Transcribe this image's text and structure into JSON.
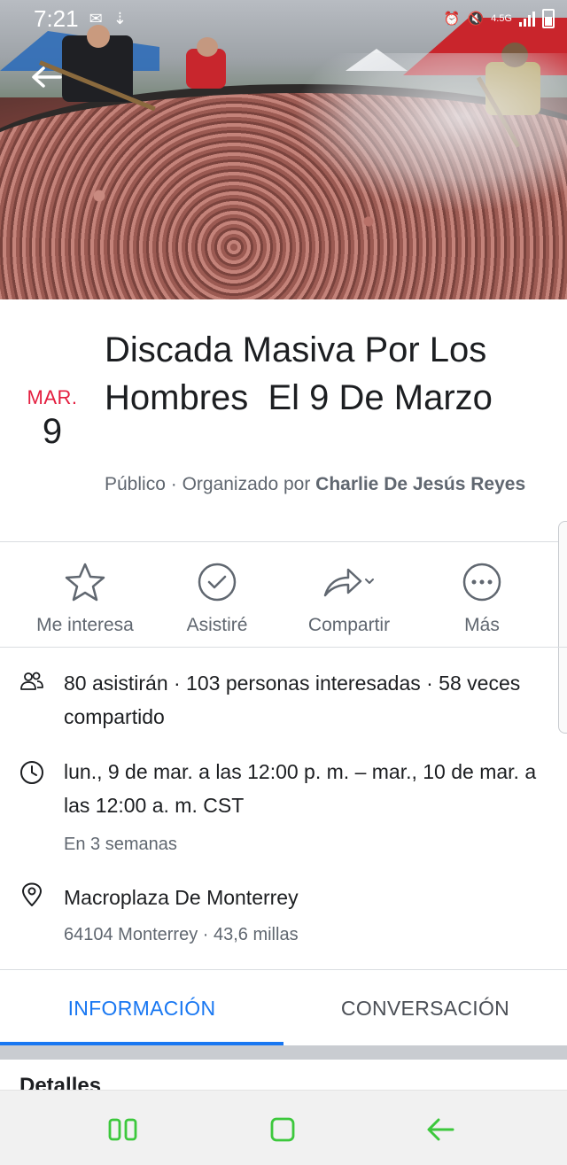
{
  "status_bar": {
    "time": "7:21",
    "network": "4.5G"
  },
  "event": {
    "month": "MAR.",
    "day": "9",
    "title": "Discada Masiva Por Los Hombres  El 9 De Marzo",
    "privacy": "Público",
    "organizer_prefix": "Organizado por",
    "organizer": "Charlie De Jesús Reyes"
  },
  "actions": [
    {
      "label": "Me interesa",
      "icon": "star-icon"
    },
    {
      "label": "Asistiré",
      "icon": "check-circle-icon"
    },
    {
      "label": "Compartir",
      "icon": "share-icon"
    },
    {
      "label": "Más",
      "icon": "more-icon"
    }
  ],
  "info": {
    "attendance": "80 asistirán · 103 personas interesadas · 58 veces compartido",
    "datetime": "lun., 9 de mar. a las 12:00 p. m. – mar., 10 de mar. a las 12:00 a. m. CST",
    "relative": "En 3 semanas",
    "location_name": "Macroplaza De Monterrey",
    "location_detail": "64104 Monterrey · 43,6 millas"
  },
  "tabs": [
    {
      "label": "INFORMACIÓN",
      "active": true
    },
    {
      "label": "CONVERSACIÓN",
      "active": false
    }
  ],
  "section_peek": "Detalles",
  "colors": {
    "accent": "#1877f2",
    "date_red": "#e41e3f",
    "nav_green": "#3cc83c"
  }
}
